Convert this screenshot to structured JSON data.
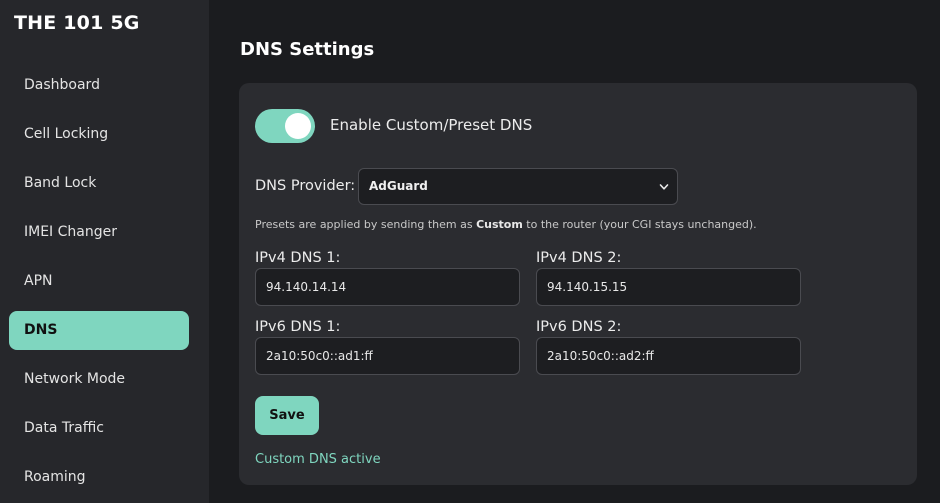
{
  "sidebar": {
    "brand": "THE 101 5G",
    "items": [
      {
        "label": "Dashboard"
      },
      {
        "label": "Cell Locking"
      },
      {
        "label": "Band Lock"
      },
      {
        "label": "IMEI Changer"
      },
      {
        "label": "APN"
      },
      {
        "label": "DNS"
      },
      {
        "label": "Network Mode"
      },
      {
        "label": "Data Traffic"
      },
      {
        "label": "Roaming"
      }
    ],
    "active_index": 5
  },
  "page": {
    "title": "DNS Settings"
  },
  "dns": {
    "toggle_label": "Enable Custom/Preset DNS",
    "toggle_on": true,
    "provider_label": "DNS Provider:",
    "provider_value": "AdGuard",
    "hint_prefix": "Presets are applied by sending them as ",
    "hint_bold": "Custom",
    "hint_suffix": " to the router (your CGI stays unchanged).",
    "ipv4_1_label": "IPv4 DNS 1:",
    "ipv4_1_value": "94.140.14.14",
    "ipv4_2_label": "IPv4 DNS 2:",
    "ipv4_2_value": "94.140.15.15",
    "ipv6_1_label": "IPv6 DNS 1:",
    "ipv6_1_value": "2a10:50c0::ad1:ff",
    "ipv6_2_label": "IPv6 DNS 2:",
    "ipv6_2_value": "2a10:50c0::ad2:ff",
    "save_label": "Save",
    "status": "Custom DNS active"
  },
  "colors": {
    "accent": "#7fd6bf",
    "sidebar_bg": "#26272b",
    "page_bg": "#1b1c1f",
    "card_bg": "#2b2c30"
  }
}
